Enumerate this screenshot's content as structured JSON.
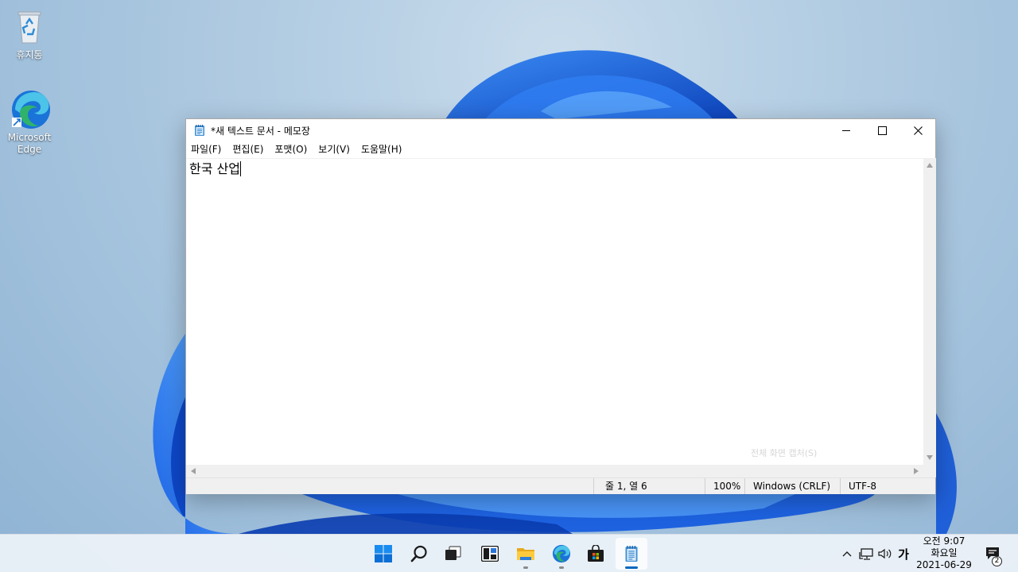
{
  "desktop": {
    "icons": [
      {
        "label": "휴지통",
        "icon": "recycle-bin-icon"
      },
      {
        "label": "Microsoft\nEdge",
        "icon": "edge-icon"
      }
    ]
  },
  "window": {
    "title": "*새 텍스트 문서 - 메모장",
    "menu": [
      "파일(F)",
      "편집(E)",
      "포맷(O)",
      "보기(V)",
      "도움말(H)"
    ],
    "editor_text": "한국 산업",
    "overlay_hint": "전체 화면 캡처(S)",
    "status": {
      "position": "줄 1, 열 6",
      "zoom": "100%",
      "line_ending": "Windows (CRLF)",
      "encoding": "UTF-8"
    }
  },
  "taskbar": {
    "apps": [
      "start",
      "search",
      "task-view",
      "widgets",
      "file-explorer",
      "edge",
      "store",
      "notepad"
    ],
    "active_app": "notepad"
  },
  "tray": {
    "ime": "가",
    "time": "오전 9:07",
    "day": "화요일",
    "date": "2021-06-29",
    "notification_count": "2"
  },
  "colors": {
    "accent": "#0067c0",
    "wallpaper_bloom": "#1a5fe0"
  }
}
